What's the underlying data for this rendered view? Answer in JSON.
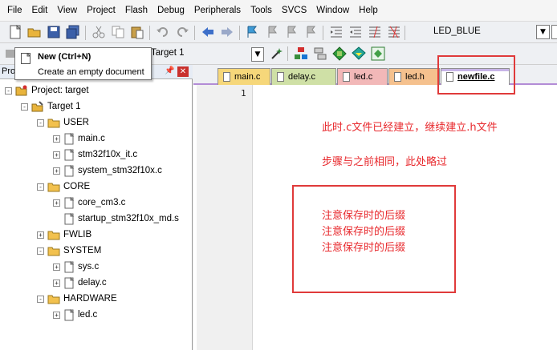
{
  "menubar": {
    "items": [
      "File",
      "Edit",
      "View",
      "Project",
      "Flash",
      "Debug",
      "Peripherals",
      "Tools",
      "SVCS",
      "Window",
      "Help"
    ]
  },
  "toolbar": {
    "target_name": "LED_BLUE",
    "build_target": "Target 1"
  },
  "tooltip": {
    "title": "New (Ctrl+N)",
    "description": "Create an empty document"
  },
  "project_panel": {
    "header": "Pro",
    "tree": [
      {
        "label": "Project: target",
        "level": 0,
        "expander": "-",
        "icon": "project-icon"
      },
      {
        "label": "Target 1",
        "level": 1,
        "expander": "-",
        "icon": "target-icon"
      },
      {
        "label": "USER",
        "level": 2,
        "expander": "-",
        "icon": "folder-icon"
      },
      {
        "label": "main.c",
        "level": 3,
        "expander": "+",
        "icon": "file-icon"
      },
      {
        "label": "stm32f10x_it.c",
        "level": 3,
        "expander": "+",
        "icon": "file-icon"
      },
      {
        "label": "system_stm32f10x.c",
        "level": 3,
        "expander": "+",
        "icon": "file-icon"
      },
      {
        "label": "CORE",
        "level": 2,
        "expander": "-",
        "icon": "folder-icon"
      },
      {
        "label": "core_cm3.c",
        "level": 3,
        "expander": "+",
        "icon": "file-icon"
      },
      {
        "label": "startup_stm32f10x_md.s",
        "level": 3,
        "expander": "",
        "icon": "file-icon"
      },
      {
        "label": "FWLIB",
        "level": 2,
        "expander": "+",
        "icon": "folder-icon"
      },
      {
        "label": "SYSTEM",
        "level": 2,
        "expander": "-",
        "icon": "folder-icon"
      },
      {
        "label": "sys.c",
        "level": 3,
        "expander": "+",
        "icon": "file-icon"
      },
      {
        "label": "delay.c",
        "level": 3,
        "expander": "+",
        "icon": "file-icon"
      },
      {
        "label": "HARDWARE",
        "level": 2,
        "expander": "-",
        "icon": "folder-icon"
      },
      {
        "label": "led.c",
        "level": 3,
        "expander": "+",
        "icon": "file-icon"
      }
    ]
  },
  "tabs": [
    {
      "label": "main.c",
      "color": "#f6d77a",
      "active": false
    },
    {
      "label": "delay.c",
      "color": "#cfe0a6",
      "active": false
    },
    {
      "label": "led.c",
      "color": "#f2b8b8",
      "active": false
    },
    {
      "label": "led.h",
      "color": "#f5c18e",
      "active": false
    },
    {
      "label": "newfile.c",
      "color": "#c8b4e8",
      "active": true
    }
  ],
  "editor": {
    "line_number": "1"
  },
  "annotations": {
    "line1": "此时.c文件已经建立，继续建立.h文件",
    "line2": "步骤与之前相同，此处略过",
    "box_lines": [
      "注意保存时的后缀",
      "注意保存时的后缀",
      "注意保存时的后缀"
    ]
  },
  "colors": {
    "annotation_red": "#e8292d",
    "active_tab_accent": "#b38cd6"
  }
}
